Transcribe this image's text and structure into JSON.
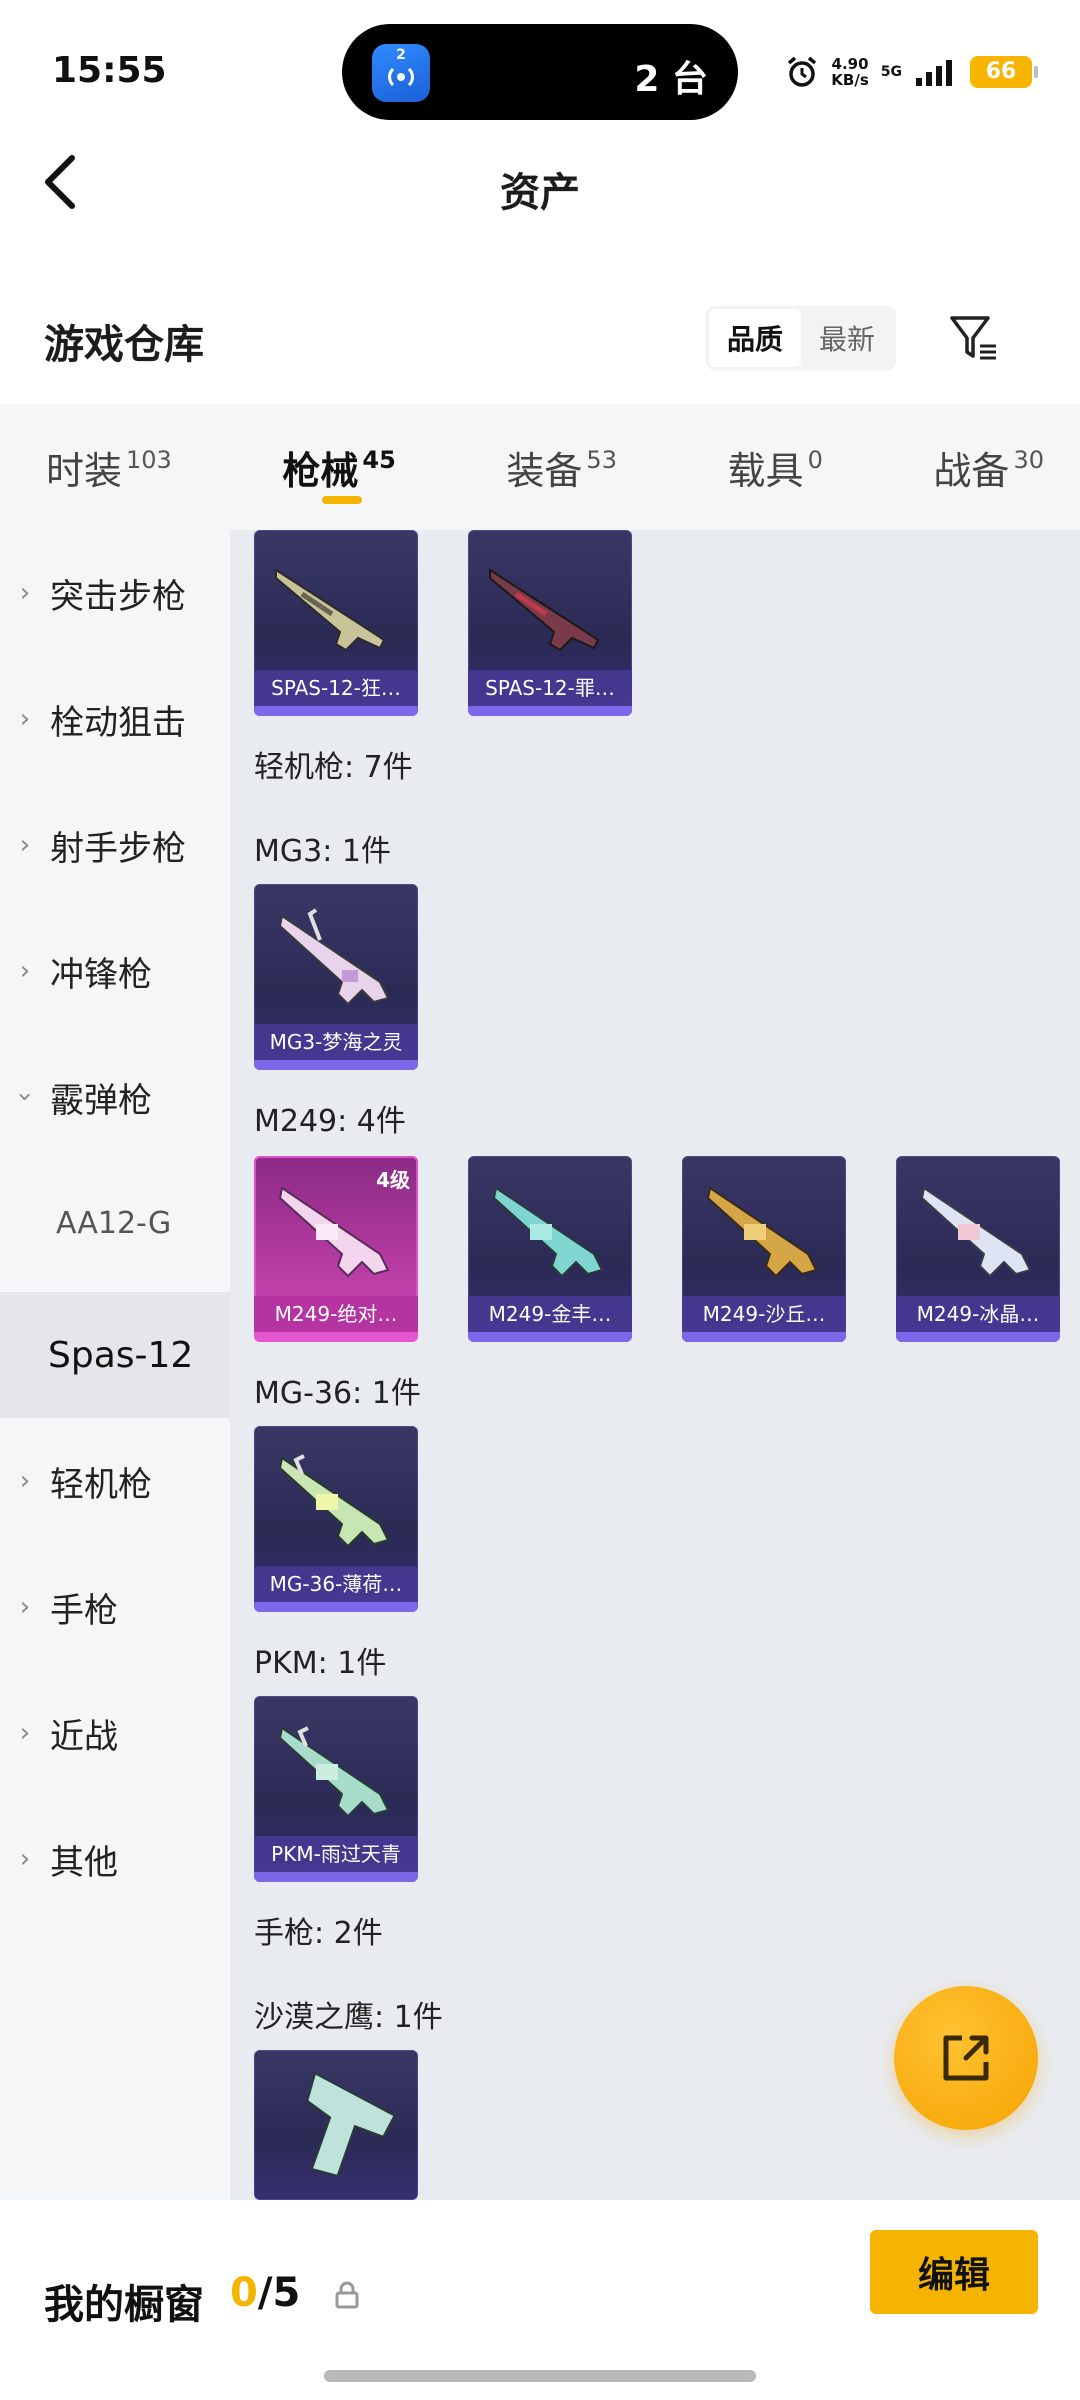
{
  "status_bar": {
    "time": "15:55",
    "island_app_badge": "2",
    "island_text": "2 台",
    "net_speed": "4.90",
    "net_unit": "KB/s",
    "network": "5G",
    "battery": "66",
    "icons": [
      "alarm-icon",
      "signal-icon",
      "battery-icon"
    ]
  },
  "header": {
    "title": "资产",
    "back_icon": "chevron-left-icon"
  },
  "section": {
    "title": "游戏仓库",
    "sort_options": [
      "品质",
      "最新"
    ],
    "sort_selected": "品质",
    "filter_icon": "filter-icon"
  },
  "tabs": [
    {
      "label": "时装",
      "count": "103"
    },
    {
      "label": "枪械",
      "count": "45"
    },
    {
      "label": "装备",
      "count": "53"
    },
    {
      "label": "载具",
      "count": "0"
    },
    {
      "label": "战备",
      "count": "30"
    }
  ],
  "tab_selected": "枪械",
  "sidebar": [
    {
      "label": "突击步枪"
    },
    {
      "label": "栓动狙击"
    },
    {
      "label": "射手步枪"
    },
    {
      "label": "冲锋枪"
    },
    {
      "label": "霰弹枪"
    },
    {
      "label": "AA12-G"
    },
    {
      "label": "Spas-12"
    },
    {
      "label": "轻机枪"
    },
    {
      "label": "手枪"
    },
    {
      "label": "近战"
    },
    {
      "label": "其他"
    }
  ],
  "content": {
    "spas_items": [
      {
        "name": "SPAS-12-狂…"
      },
      {
        "name": "SPAS-12-罪…"
      }
    ],
    "lmg_header": "轻机枪: 7件",
    "mg3_header": "MG3: 1件",
    "mg3_items": [
      {
        "name": "MG3-梦海之灵"
      }
    ],
    "m249_header": "M249: 4件",
    "m249_items": [
      {
        "name": "M249-绝对…",
        "level": "4级"
      },
      {
        "name": "M249-金丰…"
      },
      {
        "name": "M249-沙丘…"
      },
      {
        "name": "M249-冰晶…"
      }
    ],
    "mg36_header": "MG-36: 1件",
    "mg36_items": [
      {
        "name": "MG-36-薄荷…"
      }
    ],
    "pkm_header": "PKM: 1件",
    "pkm_items": [
      {
        "name": "PKM-雨过天青"
      }
    ],
    "pistol_header": "手枪: 2件",
    "deagle_header": "沙漠之鹰: 1件"
  },
  "fab_icon": "share-icon",
  "bottom": {
    "label": "我的橱窗",
    "count_current": "0",
    "count_total": "/5",
    "lock_icon": "lock-icon",
    "edit_label": "编辑"
  }
}
